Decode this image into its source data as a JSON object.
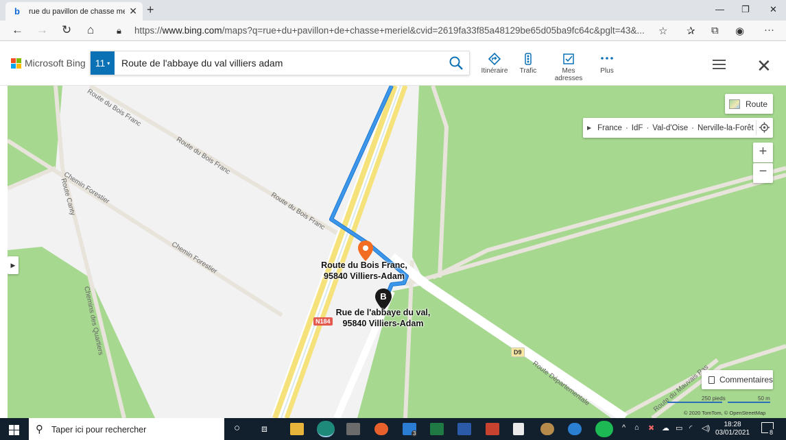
{
  "browser": {
    "tab_title": "rue du pavillon de chasse meriel",
    "url_prefix": "https://",
    "url_host": "www.bing.com",
    "url_rest": "/maps?q=rue+du+pavillon+de+chasse+meriel&cvid=2619fa33f85a48129be65d05ba9fc64c&pglt=43&..."
  },
  "bing": {
    "brand": "Microsoft Bing",
    "badge": "11",
    "query": "Route de l'abbaye du val villiers adam",
    "tools": [
      {
        "label": "Itinéraire",
        "icon": "directions-icon"
      },
      {
        "label": "Trafic",
        "icon": "traffic-icon"
      },
      {
        "label": "Mes adresses",
        "icon": "my-places-icon"
      },
      {
        "label": "Plus",
        "icon": "more-icon"
      }
    ]
  },
  "map": {
    "style_button": "Route",
    "breadcrumb": [
      "France",
      "IdF",
      "Val-d'Oise",
      "Nerville-la-Forêt"
    ],
    "feedback": "Commentaires",
    "scale_feet": "250 pieds",
    "scale_m": "50 m",
    "copyright": "© 2020 TomTom, © OpenStreetMap",
    "pins": [
      {
        "line1": "Route du Bois Franc,",
        "line2": "95840 Villiers-Adam",
        "color": "#f26c22"
      },
      {
        "letter": "B",
        "line1": "Rue de l'abbaye du val,",
        "line2": "95840 Villiers-Adam",
        "color": "#1a1a1a"
      }
    ],
    "roads": {
      "bois_franc_1": "Route du Bois Franc",
      "bois_franc_2": "Route du Bois Franc",
      "bois_franc_3": "Route du Bois Franc",
      "chemin_forestier_1": "Chemin Forestier",
      "chemin_forestier_2": "Chemin Forestier",
      "route_canty": "Route Canty",
      "chemin_quartiers": "Chemins des Quartiers",
      "route_departementale": "Route Départementale",
      "route_mauvais_pas": "Route du Mauvais Pas",
      "n184": "N184",
      "d9": "D9"
    },
    "route_color": "#3c97ea"
  },
  "taskbar": {
    "search_placeholder": "Taper ici pour rechercher",
    "time": "18:28",
    "date": "03/01/2021",
    "mail_badge": "3",
    "notif_badge": "8"
  }
}
